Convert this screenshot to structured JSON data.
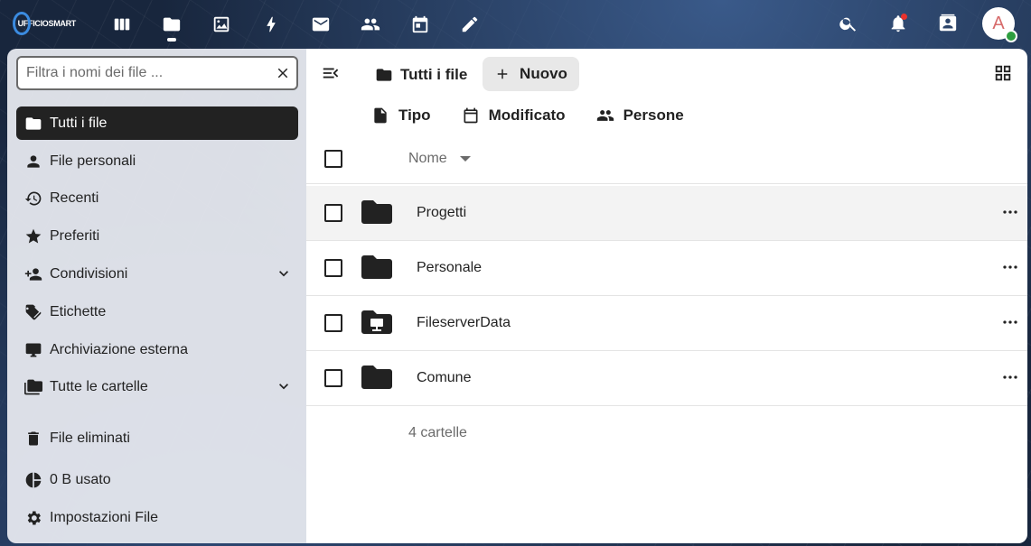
{
  "brand": {
    "logo_text": "UFFICIOSMART"
  },
  "topbar": {
    "apps": [
      {
        "name": "dashboard-icon"
      },
      {
        "name": "files-icon",
        "active": true
      },
      {
        "name": "photos-icon"
      },
      {
        "name": "activity-icon"
      },
      {
        "name": "mail-icon"
      },
      {
        "name": "contacts-icon"
      },
      {
        "name": "calendar-icon"
      },
      {
        "name": "notes-icon"
      }
    ],
    "avatar_initial": "A"
  },
  "sidebar": {
    "filter_placeholder": "Filtra i nomi dei file ...",
    "items": [
      {
        "label": "Tutti i file",
        "icon": "folder-icon",
        "active": true
      },
      {
        "label": "File personali",
        "icon": "person-icon"
      },
      {
        "label": "Recenti",
        "icon": "history-icon"
      },
      {
        "label": "Preferiti",
        "icon": "star-icon"
      },
      {
        "label": "Condivisioni",
        "icon": "share-icon",
        "expandable": true
      },
      {
        "label": "Etichette",
        "icon": "tag-icon"
      },
      {
        "label": "Archiviazione esterna",
        "icon": "external-storage-icon"
      },
      {
        "label": "Tutte le cartelle",
        "icon": "folder-multiple-icon",
        "expandable": true
      }
    ],
    "bottom": {
      "trash": "File eliminati",
      "usage": "0 B usato",
      "settings": "Impostazioni File"
    }
  },
  "main": {
    "breadcrumb": "Tutti i file",
    "new_button": "Nuovo",
    "filters": {
      "type": "Tipo",
      "modified": "Modificato",
      "people": "Persone"
    },
    "column_name": "Nome",
    "files": [
      {
        "name": "Progetti",
        "icon": "folder-icon"
      },
      {
        "name": "Personale",
        "icon": "folder-icon"
      },
      {
        "name": "FileserverData",
        "icon": "folder-network-icon"
      },
      {
        "name": "Comune",
        "icon": "folder-icon"
      }
    ],
    "summary": "4 cartelle"
  },
  "colors": {
    "active_bg": "#222222",
    "accent": "#3b8be0",
    "notification": "#e9322d",
    "online": "#2d9e3f"
  }
}
